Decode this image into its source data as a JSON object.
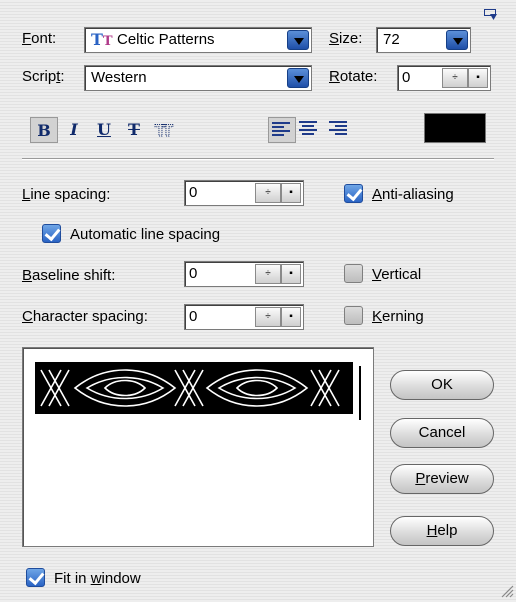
{
  "font": {
    "label": "Font:",
    "value": "Celtic Patterns",
    "type_icon": "truetype-icon"
  },
  "size": {
    "label": "Size:",
    "value": "72"
  },
  "script": {
    "label": "Script:",
    "value": "Western"
  },
  "rotate": {
    "label": "Rotate:",
    "value": "0"
  },
  "format": {
    "bold": "B",
    "italic": "I",
    "underline": "U",
    "strikethrough": "T",
    "color_hex": "#000000"
  },
  "line_spacing": {
    "label": "Line spacing:",
    "value": "0"
  },
  "anti_aliasing": {
    "label": "Anti-aliasing",
    "checked": true
  },
  "auto_line_spacing": {
    "label": "Automatic line spacing",
    "checked": true
  },
  "baseline_shift": {
    "label": "Baseline shift:",
    "value": "0"
  },
  "vertical": {
    "label": "Vertical",
    "checked": false
  },
  "character_spacing": {
    "label": "Character spacing:",
    "value": "0"
  },
  "kerning": {
    "label": "Kerning",
    "checked": false
  },
  "buttons": {
    "ok": "OK",
    "cancel": "Cancel",
    "preview": "Preview",
    "help": "Help"
  },
  "fit_in_window": {
    "label": "Fit in window",
    "checked": true
  },
  "colors": {
    "accent": "#2a63c4",
    "text_color": "#000000"
  }
}
